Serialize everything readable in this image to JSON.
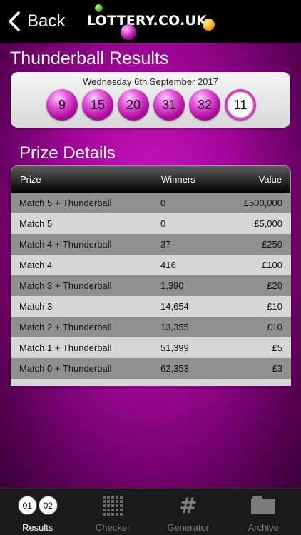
{
  "header": {
    "back_label": "Back",
    "logo_text": "LOTTERY.CO.UK"
  },
  "page": {
    "title": "Thunderball Results",
    "draw_date": "Wednesday 6th September 2017",
    "numbers": [
      "9",
      "15",
      "20",
      "31",
      "32"
    ],
    "thunderball": "11",
    "prize_heading": "Prize Details"
  },
  "table": {
    "headers": {
      "prize": "Prize",
      "winners": "Winners",
      "value": "Value"
    },
    "rows": [
      {
        "prize": "Match 5 + Thunderball",
        "winners": "0",
        "value": "£500,000"
      },
      {
        "prize": "Match 5",
        "winners": "0",
        "value": "£5,000"
      },
      {
        "prize": "Match 4 + Thunderball",
        "winners": "37",
        "value": "£250"
      },
      {
        "prize": "Match 4",
        "winners": "416",
        "value": "£100"
      },
      {
        "prize": "Match 3 + Thunderball",
        "winners": "1,390",
        "value": "£20"
      },
      {
        "prize": "Match 3",
        "winners": "14,654",
        "value": "£10"
      },
      {
        "prize": "Match 2 + Thunderball",
        "winners": "13,355",
        "value": "£10"
      },
      {
        "prize": "Match 1 + Thunderball",
        "winners": "51,399",
        "value": "£5"
      },
      {
        "prize": "Match 0 + Thunderball",
        "winners": "62,353",
        "value": "£3"
      }
    ]
  },
  "tabbar": {
    "tabs": [
      {
        "label": "Results",
        "icon": "results-balls-icon",
        "icon_text": [
          "01",
          "02"
        ],
        "active": true
      },
      {
        "label": "Checker",
        "icon": "grid-icon",
        "active": false
      },
      {
        "label": "Generator",
        "icon": "hash-icon",
        "icon_text": "#",
        "active": false
      },
      {
        "label": "Archive",
        "icon": "folder-icon",
        "active": false
      }
    ]
  },
  "colors": {
    "accent": "#a3079b",
    "header_bg": "#000000",
    "row_dark": "#8f8f8f",
    "row_light": "#d6d6d6"
  }
}
